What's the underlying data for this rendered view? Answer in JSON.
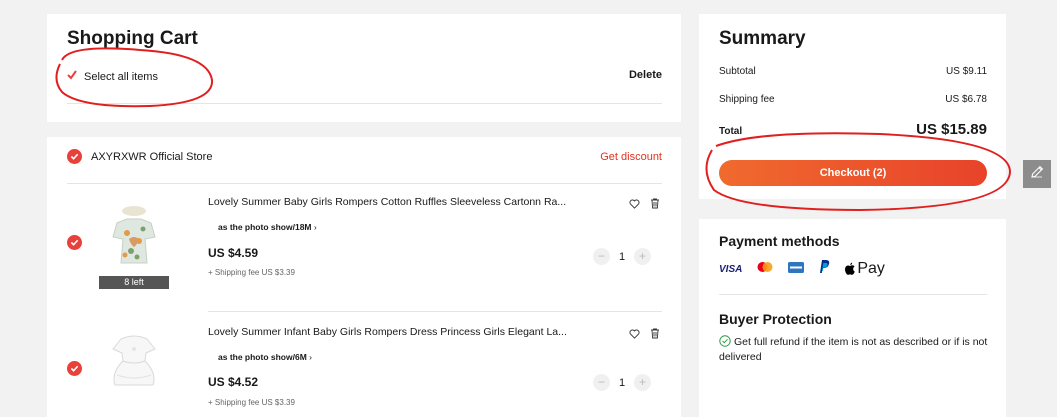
{
  "cart": {
    "title": "Shopping Cart",
    "select_all_label": "Select all items",
    "delete_label": "Delete"
  },
  "store": {
    "name": "AXYRXWR Official Store",
    "discount_label": "Get discount",
    "items": [
      {
        "title": "Lovely Summer Baby Girls Rompers Cotton Ruffles Sleeveless Cartonn Ra...",
        "variant": "as the photo show/18M",
        "price": "US $4.59",
        "shipping": "+ Shipping fee US $3.39",
        "quantity": "1",
        "stock_badge": "8 left"
      },
      {
        "title": "Lovely Summer Infant Baby Girls Rompers Dress Princess Girls Elegant La...",
        "variant": "as the photo show/6M",
        "price": "US $4.52",
        "shipping": "+ Shipping fee US $3.39",
        "quantity": "1"
      }
    ]
  },
  "summary": {
    "title": "Summary",
    "subtotal_label": "Subtotal",
    "subtotal_value": "US $9.11",
    "shipping_label": "Shipping fee",
    "shipping_value": "US $6.78",
    "total_label": "Total",
    "total_value": "US $15.89",
    "checkout_label": "Checkout (2)"
  },
  "payment": {
    "title": "Payment methods",
    "visa_label": "VISA",
    "applepay_label": "Pay",
    "icons": [
      "visa-icon",
      "mastercard-icon",
      "amex-icon",
      "paypal-icon",
      "apple-pay-icon"
    ]
  },
  "buyer_protection": {
    "title": "Buyer Protection",
    "text": "Get full refund if the item is not as described or if is not delivered"
  },
  "colors": {
    "accent_red": "#e8403a",
    "checkout_gradient_start": "#f06a2e",
    "checkout_gradient_end": "#e8432a",
    "annotation_red": "#e0201f"
  }
}
